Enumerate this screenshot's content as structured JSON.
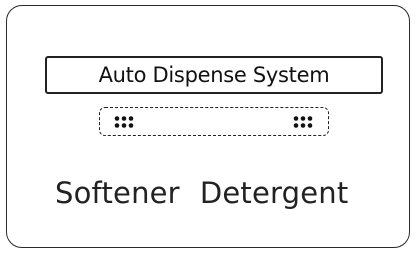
{
  "panel": {
    "title": "Auto Dispense System",
    "indicators": [
      {
        "icon": "dot-grid-icon",
        "state": "on"
      },
      {
        "icon": "dot-grid-icon",
        "state": "on"
      }
    ],
    "labels": {
      "softener": "Softener",
      "detergent": "Detergent"
    }
  }
}
